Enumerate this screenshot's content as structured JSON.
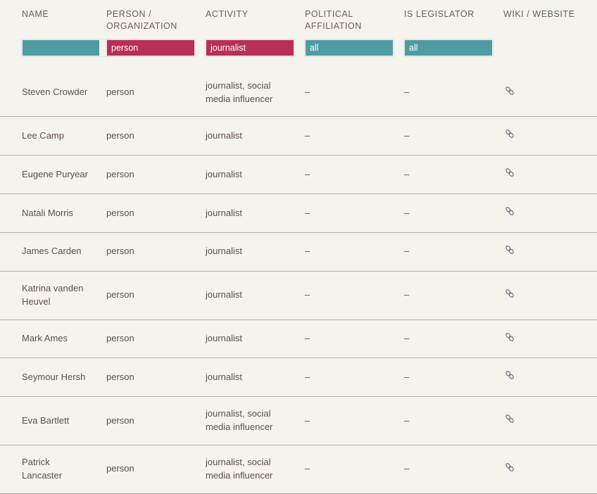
{
  "table": {
    "columns": [
      {
        "key": "name",
        "label": "NAME"
      },
      {
        "key": "person_org",
        "label": "PERSON /\nORGANIZATION"
      },
      {
        "key": "activity",
        "label": "ACTIVITY"
      },
      {
        "key": "political",
        "label": "POLITICAL\nAFFILIATION"
      },
      {
        "key": "legislator",
        "label": "IS LEGISLATOR"
      },
      {
        "key": "wiki",
        "label": "WIKI / WEBSITE"
      }
    ],
    "filters": [
      {
        "column": "name",
        "value": "",
        "style": "teal",
        "present": true
      },
      {
        "column": "person_org",
        "value": "person",
        "style": "crimson",
        "present": true
      },
      {
        "column": "activity",
        "value": "journalist",
        "style": "crimson",
        "present": true
      },
      {
        "column": "political",
        "value": "all",
        "style": "teal",
        "present": true
      },
      {
        "column": "legislator",
        "value": "all",
        "style": "teal",
        "present": true
      },
      {
        "column": "wiki",
        "value": "",
        "style": "none",
        "present": false
      }
    ],
    "rows": [
      {
        "name": "Steven Crowder",
        "person_org": "person",
        "activity": "journalist, social media influencer",
        "political": "–",
        "legislator": "–",
        "wiki": "link-icon"
      },
      {
        "name": "Lee Camp",
        "person_org": "person",
        "activity": "journalist",
        "political": "–",
        "legislator": "–",
        "wiki": "link-icon"
      },
      {
        "name": "Eugene Puryear",
        "person_org": "person",
        "activity": "journalist",
        "political": "–",
        "legislator": "–",
        "wiki": "link-icon"
      },
      {
        "name": "Natali Morris",
        "person_org": "person",
        "activity": "journalist",
        "political": "–",
        "legislator": "–",
        "wiki": "link-icon"
      },
      {
        "name": "James Carden",
        "person_org": "person",
        "activity": "journalist",
        "political": "–",
        "legislator": "–",
        "wiki": "link-icon"
      },
      {
        "name": "Katrina vanden Heuvel",
        "person_org": "person",
        "activity": "journalist",
        "political": "–",
        "legislator": "–",
        "wiki": "link-icon"
      },
      {
        "name": "Mark Ames",
        "person_org": "person",
        "activity": "journalist",
        "political": "–",
        "legislator": "–",
        "wiki": "link-icon"
      },
      {
        "name": "Seymour Hersh",
        "person_org": "person",
        "activity": "journalist",
        "political": "–",
        "legislator": "–",
        "wiki": "link-icon"
      },
      {
        "name": "Eva Bartlett",
        "person_org": "person",
        "activity": "journalist, social media influencer",
        "political": "–",
        "legislator": "–",
        "wiki": "link-icon"
      },
      {
        "name": "Patrick Lancaster",
        "person_org": "person",
        "activity": "journalist, social media influencer",
        "political": "–",
        "legislator": "–",
        "wiki": "link-icon"
      }
    ]
  },
  "colors": {
    "background": "#f5f3ee",
    "filter_teal": "#4e9ca3",
    "filter_crimson": "#b83055",
    "row_divider": "#b3a9a3",
    "text": "#5c5049",
    "header_text": "#6d5f57"
  }
}
